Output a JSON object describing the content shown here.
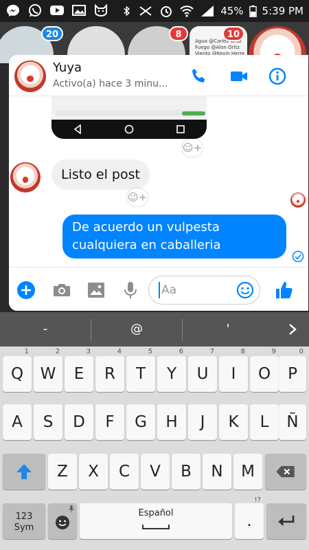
{
  "status_bar": {
    "battery": "45%",
    "time": "5:39 PM"
  },
  "background_heads": {
    "badges": [
      "20",
      "8",
      "10"
    ],
    "snippet_lines": [
      "Agua @Carlos Oruz",
      "Fuego @Alon Ortiz",
      "Viento @Kevin Herre"
    ]
  },
  "chat": {
    "contact_name": "Yuya",
    "contact_status": "Activo(a) hace 3 minu...",
    "incoming_message": "Listo el post",
    "outgoing_message": "De acuerdo un vulpesta cualquiera en caballeria",
    "input_placeholder": "Aa"
  },
  "keyboard": {
    "suggestions": [
      "-",
      "@",
      "'"
    ],
    "row1": [
      {
        "label": "Q",
        "hint": "1"
      },
      {
        "label": "W",
        "hint": "2"
      },
      {
        "label": "E",
        "hint": "3"
      },
      {
        "label": "R",
        "hint": "4"
      },
      {
        "label": "T",
        "hint": "5"
      },
      {
        "label": "Y",
        "hint": "6"
      },
      {
        "label": "U",
        "hint": "7"
      },
      {
        "label": "I",
        "hint": "8"
      },
      {
        "label": "O",
        "hint": "9"
      },
      {
        "label": "P",
        "hint": "0"
      }
    ],
    "row2": [
      "A",
      "S",
      "D",
      "F",
      "G",
      "H",
      "J",
      "K",
      "L",
      "Ñ"
    ],
    "row3": [
      "Z",
      "X",
      "C",
      "V",
      "B",
      "N",
      "M"
    ],
    "sym_key": "123\nSym",
    "space_label": "Español",
    "period_hint": "!?",
    "period_label": "."
  },
  "colors": {
    "accent": "#0084ff",
    "badge_red": "#e53935"
  }
}
